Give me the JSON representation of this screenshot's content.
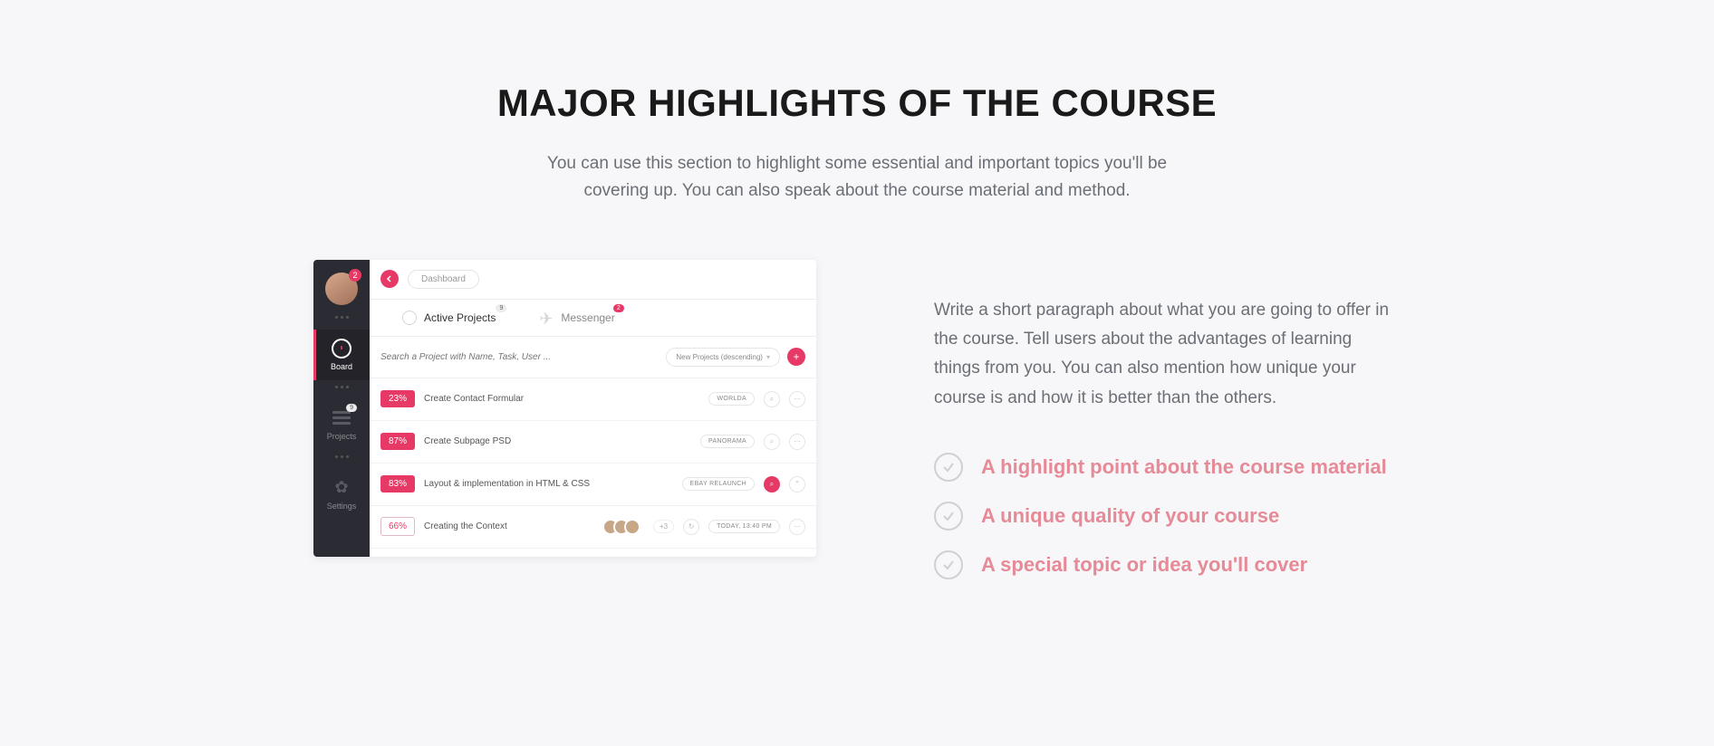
{
  "section": {
    "title": "MAJOR HIGHLIGHTS OF THE COURSE",
    "subtitle": "You can use this section to highlight some essential and important topics you'll be covering up. You can also speak about the course material and method."
  },
  "mockapp": {
    "avatar_badge": "2",
    "nav": [
      {
        "label": "Board",
        "active": true
      },
      {
        "label": "Projects",
        "badge": "9"
      },
      {
        "label": "Settings"
      }
    ],
    "breadcrumb": "Dashboard",
    "tabs": [
      {
        "label": "Active Projects",
        "badge": "9",
        "active": true
      },
      {
        "label": "Messenger",
        "badge": "2"
      }
    ],
    "search_placeholder": "Search a Project with Name, Task, User ...",
    "sort_label": "New Projects (descending)",
    "rows": [
      {
        "pct": "23%",
        "title": "Create Contact Formular",
        "tag": "WORLDA"
      },
      {
        "pct": "87%",
        "title": "Create Subpage PSD",
        "tag": "PANORAMA"
      },
      {
        "pct": "83%",
        "title": "Layout & implementation in HTML & CSS",
        "tag": "EBAY RELAUNCH"
      },
      {
        "pct": "66%",
        "title": "Creating the Context",
        "tag": "",
        "extra_count": "+3",
        "time": "TODAY, 13:40 PM"
      }
    ]
  },
  "right_column": {
    "paragraph": "Write a short paragraph about what you are going to offer in the course. Tell users about the advantages of learning things from you. You can also mention how unique your course is and how it is better than the others.",
    "highlights": [
      "A highlight point about the course material",
      "A unique quality of your course",
      "A special topic or idea you'll cover"
    ]
  }
}
